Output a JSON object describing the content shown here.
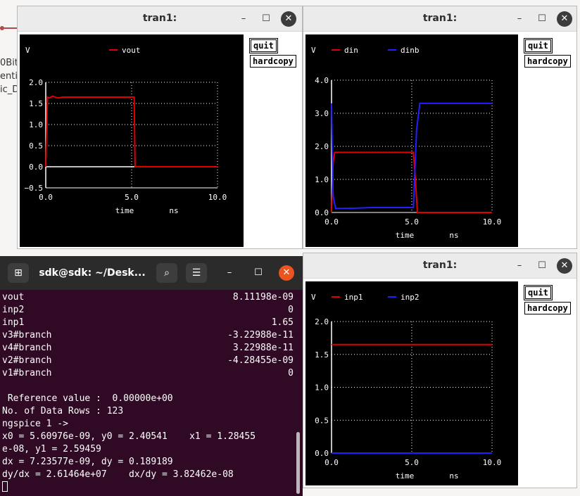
{
  "background_fragments": [
    "0Bit",
    "enti",
    "ic_D"
  ],
  "plot_windows": [
    {
      "title": "tran1:",
      "buttons": {
        "quit": "quit",
        "hardcopy": "hardcopy"
      },
      "chart_data": {
        "type": "line",
        "ylabel": "V",
        "xlabel": "time",
        "xunit": "ns",
        "xlim": [
          0,
          10
        ],
        "ylim": [
          -0.5,
          2.0
        ],
        "xticks": [
          "0.0",
          "5.0",
          "10.0"
        ],
        "yticks": [
          "−0.5",
          "0.0",
          "0.5",
          "1.0",
          "1.5",
          "2.0"
        ],
        "series": [
          {
            "name": "vout",
            "color": "#e00000",
            "x": [
              0,
              0.1,
              0.2,
              0.4,
              0.7,
              1.0,
              2.0,
              5.15,
              5.2,
              10
            ],
            "y": [
              0,
              1.65,
              1.63,
              1.67,
              1.63,
              1.65,
              1.65,
              1.65,
              0,
              0
            ]
          }
        ]
      }
    },
    {
      "title": "tran1:",
      "buttons": {
        "quit": "quit",
        "hardcopy": "hardcopy"
      },
      "chart_data": {
        "type": "line",
        "ylabel": "V",
        "xlabel": "time",
        "xunit": "ns",
        "xlim": [
          0,
          10
        ],
        "ylim": [
          0,
          4.0
        ],
        "xticks": [
          "0.0",
          "5.0",
          "10.0"
        ],
        "yticks": [
          "0.0",
          "1.0",
          "2.0",
          "3.0",
          "4.0"
        ],
        "series": [
          {
            "name": "din",
            "color": "#e00000",
            "x": [
              0,
              0.1,
              0.2,
              5.1,
              5.2,
              5.35,
              10
            ],
            "y": [
              0,
              1.5,
              1.82,
              1.82,
              1.2,
              0,
              0
            ]
          },
          {
            "name": "dinb",
            "color": "#2020ff",
            "x": [
              0,
              0.1,
              0.25,
              1.5,
              2.5,
              5.1,
              5.3,
              5.5,
              10
            ],
            "y": [
              3.3,
              0.5,
              0.12,
              0.13,
              0.15,
              0.15,
              2.5,
              3.3,
              3.3
            ]
          }
        ]
      }
    },
    {
      "title": "tran1:",
      "buttons": {
        "quit": "quit",
        "hardcopy": "hardcopy"
      },
      "chart_data": {
        "type": "line",
        "ylabel": "V",
        "xlabel": "time",
        "xunit": "ns",
        "xlim": [
          0,
          10
        ],
        "ylim": [
          0,
          2.0
        ],
        "xticks": [
          "0.0",
          "5.0",
          "10.0"
        ],
        "yticks": [
          "0.0",
          "0.5",
          "1.0",
          "1.5",
          "2.0"
        ],
        "series": [
          {
            "name": "inp1",
            "color": "#e00000",
            "x": [
              0,
              10
            ],
            "y": [
              1.65,
              1.65
            ]
          },
          {
            "name": "inp2",
            "color": "#2020ff",
            "x": [
              0,
              10
            ],
            "y": [
              0,
              0
            ]
          }
        ]
      }
    }
  ],
  "terminal": {
    "title": "sdk@sdk: ~/Desk...",
    "rows": [
      {
        "name": "vout",
        "value": "8.11198e-09"
      },
      {
        "name": "inp2",
        "value": "0"
      },
      {
        "name": "inp1",
        "value": "1.65"
      },
      {
        "name": "v3#branch",
        "value": "-3.22988e-11"
      },
      {
        "name": "v4#branch",
        "value": "3.22988e-11"
      },
      {
        "name": "v2#branch",
        "value": "-4.28455e-09"
      },
      {
        "name": "v1#branch",
        "value": "0"
      }
    ],
    "lines": [
      "",
      " Reference value :  0.00000e+00",
      "No. of Data Rows : 123",
      "ngspice 1 ->",
      "x0 = 5.60976e-09, y0 = 2.40541    x1 = 1.28455",
      "e-08, y1 = 2.59459",
      "dx = 7.23577e-09, dy = 0.189189",
      "dy/dx = 2.61464e+07    dx/dy = 3.82462e-08"
    ]
  },
  "colors": {
    "grid": "#ffffff",
    "axis_text": "#ffffff",
    "terminal_bg": "#300a24",
    "close_orange": "#e95420"
  }
}
